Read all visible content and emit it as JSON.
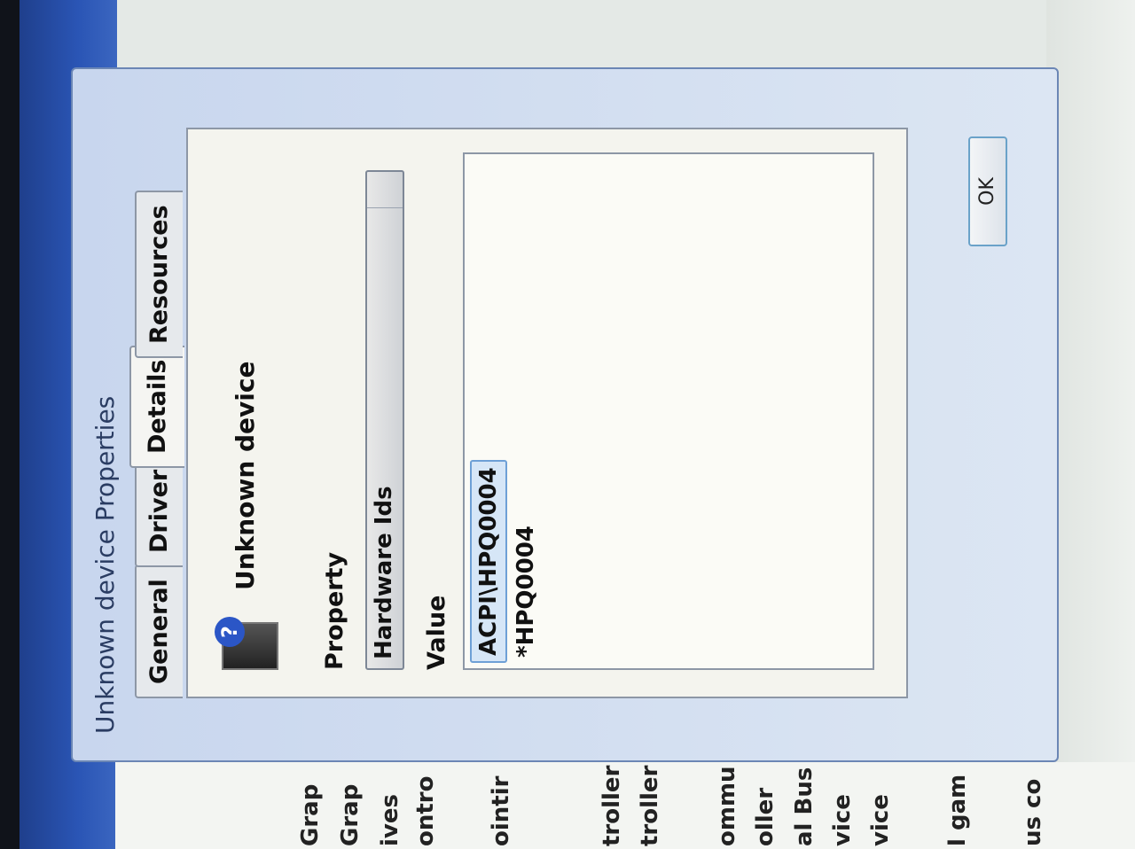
{
  "dialog": {
    "title": "Unknown device Properties",
    "tabs": [
      {
        "label": "General"
      },
      {
        "label": "Driver"
      },
      {
        "label": "Details"
      },
      {
        "label": "Resources"
      }
    ],
    "device_name": "Unknown device",
    "property_label": "Property",
    "property_selected": "Hardware Ids",
    "value_label": "Value",
    "values": [
      "ACPI\\HPQ0004",
      "*HPQ0004"
    ],
    "ok_label": "OK"
  },
  "background_list": {
    "items": [
      "Grap",
      "Grap",
      "ives",
      "ontro",
      "ointir",
      "troller",
      "troller",
      "ommu",
      "oller",
      "al Bus",
      "vice",
      "vice",
      "l gam",
      "us co"
    ]
  }
}
